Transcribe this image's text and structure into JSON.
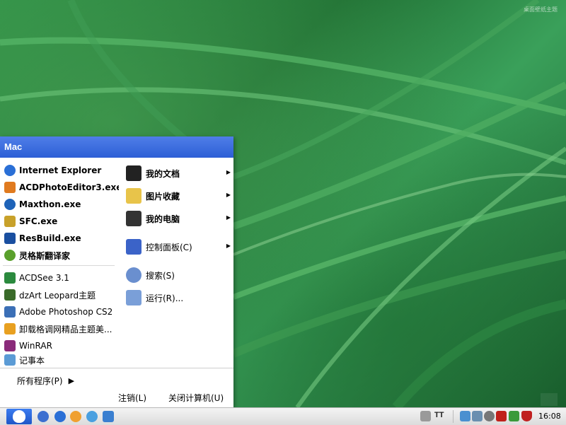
{
  "desktop": {
    "watermark": "桌面壁纸主题"
  },
  "start_menu": {
    "user": "Mac",
    "pinned": [
      {
        "label": "Internet Explorer",
        "icon": "ie-icon",
        "color": "#2a6fd6"
      },
      {
        "label": "ACDPhotoEditor3.exe",
        "icon": "acd-photo-editor-icon",
        "color": "#e07a1f"
      },
      {
        "label": "Maxthon.exe",
        "icon": "maxthon-icon",
        "color": "#1e63b8"
      },
      {
        "label": "SFC.exe",
        "icon": "sfc-icon",
        "color": "#c8a12a"
      },
      {
        "label": "ResBuild.exe",
        "icon": "resbuild-icon",
        "color": "#1a4fa0"
      },
      {
        "label": "灵格斯翻译家",
        "icon": "lingoes-icon",
        "color": "#5aa02c"
      }
    ],
    "recent": [
      {
        "label": "ACDSee 3.1",
        "icon": "acdsee-icon",
        "color": "#2b8a3e"
      },
      {
        "label": "dzArt Leopard主题",
        "icon": "dzart-icon",
        "color": "#3a6b2a"
      },
      {
        "label": "Adobe Photoshop CS2",
        "icon": "photoshop-icon",
        "color": "#3b6fb6"
      },
      {
        "label": "卸载格调网精品主题美...",
        "icon": "uninstall-icon",
        "color": "#e8a020"
      },
      {
        "label": "WinRAR",
        "icon": "winrar-icon",
        "color": "#8a2b7a"
      },
      {
        "label": "记事本",
        "icon": "notepad-icon",
        "color": "#5b9bd5"
      }
    ],
    "right": [
      {
        "label": "我的文档",
        "icon": "my-documents-icon",
        "color": "#222222",
        "bold": true,
        "arrow": true
      },
      {
        "label": "图片收藏",
        "icon": "my-pictures-icon",
        "color": "#e8c44a",
        "bold": true,
        "arrow": true
      },
      {
        "label": "我的电脑",
        "icon": "my-computer-icon",
        "color": "#333333",
        "bold": true,
        "arrow": true
      },
      {
        "label": "控制面板(C)",
        "icon": "control-panel-icon",
        "color": "#3b63c8",
        "bold": false,
        "arrow": true
      },
      {
        "label": "搜索(S)",
        "icon": "search-icon",
        "color": "#6a8fcf",
        "bold": false,
        "arrow": false
      },
      {
        "label": "运行(R)...",
        "icon": "run-icon",
        "color": "#7a9fd8",
        "bold": false,
        "arrow": false
      }
    ],
    "all_programs": "所有程序(P)",
    "logoff": "注销(L)",
    "shutdown": "关闭计算机(U)"
  },
  "taskbar": {
    "quick_launch": [
      {
        "icon": "media-player-icon",
        "color": "#3c6fd0"
      },
      {
        "label": "",
        "icon": "ie-quicklaunch-icon",
        "color": "#2a6fd6"
      },
      {
        "icon": "qq-icon",
        "color": "#f0a030"
      },
      {
        "icon": "messenger-icon",
        "color": "#4aa0e0"
      },
      {
        "icon": "settings-icon",
        "color": "#3a7fd0"
      }
    ],
    "tray_text": "TT",
    "tray_icons": [
      {
        "icon": "language-bar-icon",
        "color": "#4a90d0"
      },
      {
        "icon": "network-icon",
        "color": "#6a8fb0"
      },
      {
        "icon": "volume-icon",
        "color": "#777777"
      },
      {
        "icon": "antivirus-icon",
        "color": "#c0201a"
      },
      {
        "icon": "green-app-icon",
        "color": "#3a9a3a"
      },
      {
        "icon": "shield-icon",
        "color": "#c02020"
      }
    ],
    "clock": "16:08"
  }
}
